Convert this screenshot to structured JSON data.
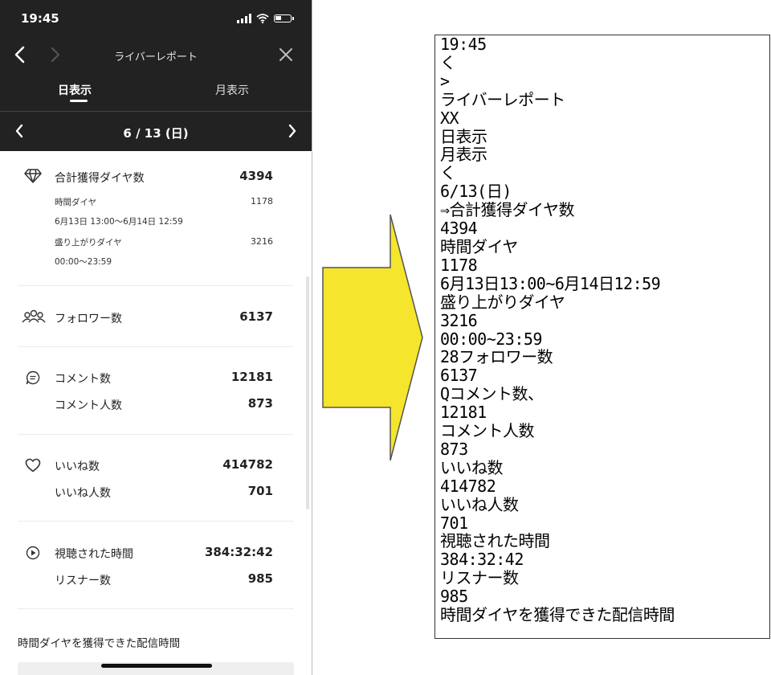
{
  "phone": {
    "status_time": "19:45",
    "nav": {
      "title": "ライバーレポート"
    },
    "tabs": [
      {
        "label": "日表示",
        "selected": true
      },
      {
        "label": "月表示",
        "selected": false
      }
    ],
    "date": "6 / 13 (日)",
    "sections": {
      "diamonds": {
        "label": "合計獲得ダイヤ数",
        "value": "4394",
        "time_diamond_label": "時間ダイヤ",
        "time_diamond_value": "1178",
        "time_diamond_range": "6月13日 13:00〜6月14日 12:59",
        "hype_diamond_label": "盛り上がりダイヤ",
        "hype_diamond_value": "3216",
        "hype_diamond_range": "00:00〜23:59"
      },
      "followers": {
        "label": "フォロワー数",
        "value": "6137"
      },
      "comments": {
        "label": "コメント数",
        "value": "12181",
        "people_label": "コメント人数",
        "people_value": "873"
      },
      "likes": {
        "label": "いいね数",
        "value": "414782",
        "people_label": "いいね人数",
        "people_value": "701"
      },
      "watch": {
        "label": "視聴された時間",
        "value": "384:32:42",
        "listeners_label": "リスナー数",
        "listeners_value": "985"
      }
    },
    "footer_title": "時間ダイヤを獲得できた配信時間"
  },
  "ocr_lines": [
    "19:45",
    "く",
    ">",
    "ライバーレポート",
    "XX",
    "日表示",
    "月表示",
    "く",
    "6/13(日)",
    "⇒合計獲得ダイヤ数",
    "4394",
    "時間ダイヤ",
    "1178",
    "6月13日13:00~6月14日12:59",
    "盛り上がりダイヤ",
    "3216",
    "00:00~23:59",
    "28フォロワー数",
    "6137",
    "Qコメント数、",
    "12181",
    "コメント人数",
    "873",
    "いいね数",
    "414782",
    "いいね人数",
    "701",
    "視聴された時間",
    "384:32:42",
    "リスナー数",
    "985",
    "時間ダイヤを獲得できた配信時間"
  ],
  "colors": {
    "header_bg": "#222222",
    "arrow_fill": "#f5e52c",
    "text": "#222222"
  }
}
